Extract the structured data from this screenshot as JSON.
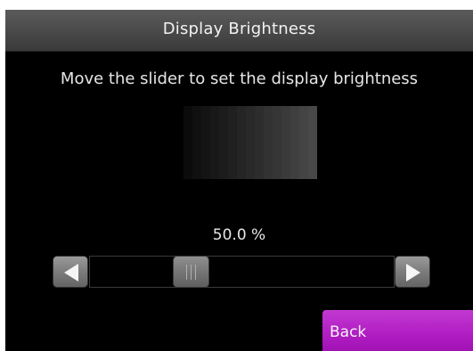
{
  "header": {
    "title": "Display Brightness"
  },
  "instruction": "Move the slider to set the display brightness",
  "brightness": {
    "percent_text": "50.0 %",
    "level": 0.5
  },
  "swatch": {
    "shades": [
      "#0b0b0b",
      "#101010",
      "#141414",
      "#181818",
      "#1c1c1c",
      "#202020",
      "#252525",
      "#292929",
      "#2d2d2d",
      "#323232",
      "#363636",
      "#3a3a3a",
      "#3f3f3f",
      "#444444",
      "#484848"
    ]
  },
  "slider": {
    "decrease_icon": "triangle-left-icon",
    "increase_icon": "triangle-right-icon",
    "thumb_icon": "grip-lines-icon"
  },
  "footer": {
    "back_label": "Back"
  },
  "colors": {
    "accent": "#b21fc4",
    "header": "#4c4c4c",
    "background": "#000000"
  }
}
